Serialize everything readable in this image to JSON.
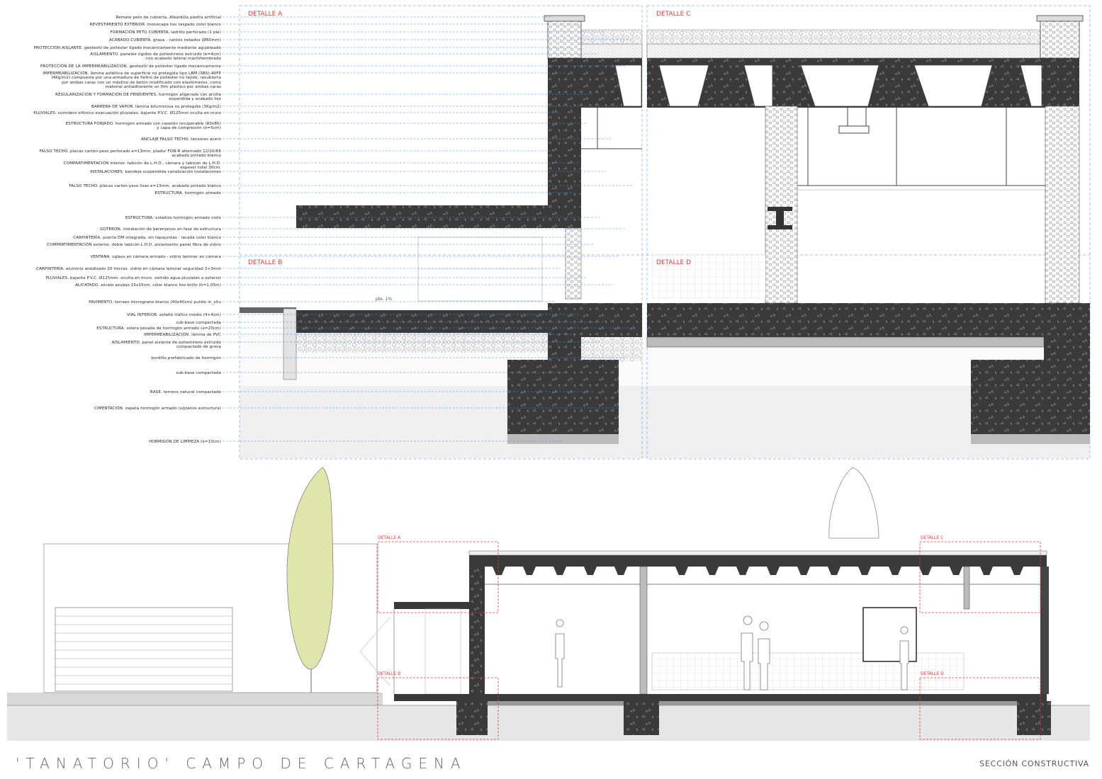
{
  "title": "'TANATORIO' CAMPO DE CARTAGENA",
  "subtitle": "SECCIÓN CONSTRUCTIVA",
  "details_large": [
    "DETALLE A",
    "DETALLE C",
    "DETALLE B",
    "DETALLE D"
  ],
  "details_small": [
    "DETALLE A",
    "DETALLE C",
    "DETALLE B",
    "DETALLE D"
  ],
  "slope_label": "pte. 1%",
  "colors": {
    "detail_red": "#e23b3b",
    "leader_blue": "#3a8fe8",
    "concrete": "#3c3c3c",
    "insulation": "#d6d6d6",
    "tree_fill": "#e8ecb4"
  },
  "annotations": [
    "Remate peto de cubierta. Albardilla piedra artificial",
    "REVESTIMIENTO EXTERIOR. monocapa liso raspado color blanco",
    "FORMACIÓN PETO CUBIERTA. ladrillo perforado (1 pie)",
    "ACABADO CUBIERTA. grava - cantos rodados (Ø60mm)",
    "PROTECCIÓN AISLANTE. geotextil de poliéster ligado mecánicamente mediante agujeteado",
    "AISLAMIENTO. paneles rígidos de poliestireno extruido (e=4cm)\ncon acabado lateral machihembrado",
    "PROTECCIÓN DE LA IMPERMEABILIZACIÓN. geotextil de poliéster ligado mecánicamente",
    "IMPERMEABILIZACIÓN. lámina asfáltica de superficie no protegida tipo LBM (SBS)-40FP\n(4Kg/m2) compuesta por una armadura de fieltro de poliéster no tejido, recubierta\npor ambas caras con un mástico de betún modificado con elastómeros, como\nmaterial antiadherente un film plástico por ambas caras",
    "REGULARIZACIÓN Y FORMACIÓN DE PENDIENTES. hormigón aligerado con arcilla\nexpandida y acabado liso",
    "BARRERA DE VAPOR. lámina bituminosa no protegida (3Kg/m2)",
    "PLUVIALES. sumidero sifónico evacuación pluviales. bajante P.V.C. Ø125mm oculta en muro",
    "ESTRUCTURA FORJADO. hormigón armado con casetón recuperable (80x80)\ny capa de compresión (e=5cm)",
    "ANCLAJE FALSO TECHO. tensores acero",
    "FALSO TECHO. placas cartón-yeso perforado e=13mm, pladur FON-R alternado 12/20/66\nacabado pintado blanco",
    "COMPARTIMENTACIÓN interior. tabicón de L.H.D., cámara y tabicón de L.H.D.\nespesor total 30cm.",
    "INSTALACIONES. bandeja suspendida canalización instalaciones",
    "FALSO TECHO. placas cartón-yeso lisas e=13mm. acabado pintado blanco",
    "ESTRUCTURA. hormigón armado",
    "ESTRUCTURA. voladizo hormigón armado visto",
    "GOTERÓN. instalación de berenjenos en fase de estructura",
    "CARPINTERÍA. puerta DM integrada, sin tapajuntas - lacada color blanco",
    "COMPARTIMENTACIÓN exterior. doble tabicón L.H.D. aislamiento panel fibra de vidrio",
    "VENTANA. uglass en cámara armado - vidrio laminar en cámara",
    "CARPINTERÍA. aluminio anodizado 20 micras. vidrio en cámara laminar seguridad 3+3mm",
    "PLUVIALES. bajante P.V.C. Ø125mm. oculta en muro. vertido agua pluviales a exterior",
    "ALICATADO. zócalo azulejo 15x15cm. color blanco liso brillo (h=1.05m)",
    "PAVIMENTO. terrazo micrograno blanco (40x40cm) pulido in_situ",
    "VIAL INTERIOR. asfalto tráfico medio (4+4cm)",
    "sub-base compactada",
    "ESTRUCTURA. solera pesada de hormigón armado (e=20cm)",
    "IMPERMEABILIZACIÓN. lámina de PVC",
    "AISLAMIENTO. panel aislante de poliestireno extruido\ncompactado de grava",
    "bordillo prefabricado de hormigón",
    "sub-base compactada",
    "BASE. terreno natural compactado",
    "CIMENTACIÓN. zapata hormigón armado (s/planos estructura)",
    "HORMIGÓN DE LIMPIEZA (e=10cm)"
  ]
}
